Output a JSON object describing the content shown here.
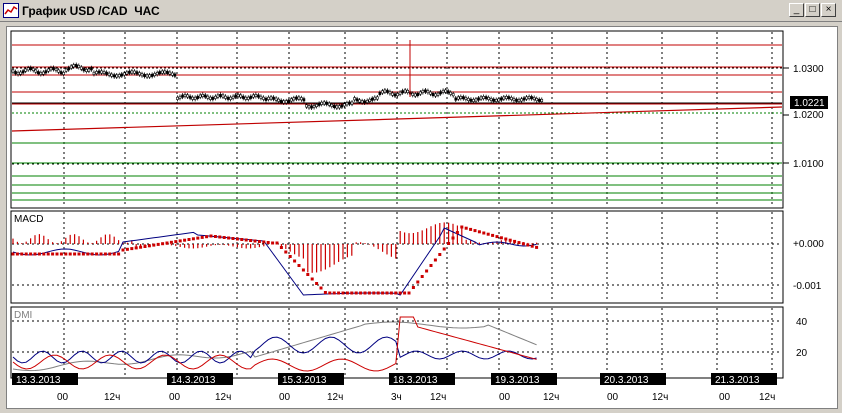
{
  "window": {
    "title": "График USD /CAD  ЧАС",
    "minimize_glyph": "_",
    "maximize_glyph": "□",
    "close_glyph": "×"
  },
  "colors": {
    "background": "#ffffff",
    "grid": "#000000",
    "resistance_lines": "#c00000",
    "support_lines": "#008000",
    "trendline": "#c00000",
    "macd_line": "#000080",
    "macd_signal": "#cc0000",
    "macd_hist": "#cc0000",
    "dmi_adx": "#808080",
    "dmi_plus": "#000080",
    "dmi_minus": "#cc0000",
    "last_price_bg": "#000000",
    "last_price_fg": "#ffffff"
  },
  "price_panel": {
    "price_labels": [
      "1.0300",
      "1.0200",
      "1.0100"
    ],
    "last_price": "1.0221"
  },
  "macd_panel": {
    "label": "MACD",
    "scale_labels": [
      "+0.000",
      "-0.001"
    ]
  },
  "dmi_panel": {
    "label": "DMI",
    "scale_labels": [
      "40",
      "20"
    ]
  },
  "time_axis": {
    "dates": [
      "13.3.2013",
      "14.3.2013",
      "15.3.2013",
      "18.3.2013",
      "19.3.2013",
      "20.3.2013",
      "21.3.2013"
    ],
    "hours": [
      {
        "label": "00"
      },
      {
        "label": "12ч"
      },
      {
        "label": "00"
      },
      {
        "label": "12ч"
      },
      {
        "label": "00"
      },
      {
        "label": "12ч"
      },
      {
        "label": "3ч"
      },
      {
        "label": "12ч"
      },
      {
        "label": "00"
      },
      {
        "label": "12ч"
      },
      {
        "label": "00"
      },
      {
        "label": "12ч"
      },
      {
        "label": "00"
      },
      {
        "label": "12ч"
      }
    ]
  }
}
